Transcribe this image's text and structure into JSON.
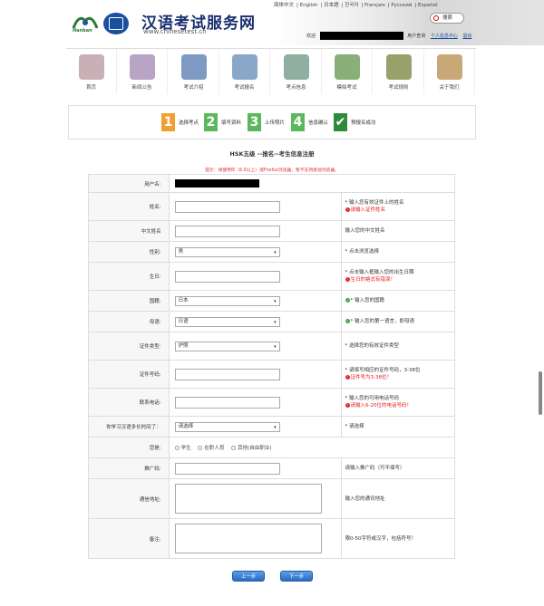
{
  "header": {
    "site_title": "汉语考试服务网",
    "site_url": "www.chinesetest.cn",
    "logo_text": "Hanban",
    "languages": [
      "简体中文",
      "English",
      "日本語",
      "한국어",
      "Français",
      "Русский",
      "Español"
    ],
    "search_label": "搜索",
    "welcome": "欢迎",
    "user_center": "用户查询",
    "personal_center": "个人信息中心",
    "logout": "退出"
  },
  "nav": {
    "items": [
      {
        "label": "首页",
        "color": "#c9b0b6"
      },
      {
        "label": "新闻公告",
        "color": "#b8a4c4"
      },
      {
        "label": "考试介绍",
        "color": "#7f9ac2"
      },
      {
        "label": "考试报名",
        "color": "#8aa6c8"
      },
      {
        "label": "考点信息",
        "color": "#8fb0a0"
      },
      {
        "label": "模拟考试",
        "color": "#8ab07a"
      },
      {
        "label": "考试规则",
        "color": "#9aa06a"
      },
      {
        "label": "关于我们",
        "color": "#c8a878"
      }
    ]
  },
  "steps": [
    {
      "num": "1",
      "label": "选择考点",
      "color": "#f0a030"
    },
    {
      "num": "2",
      "label": "填写资料",
      "color": "#5cb85c"
    },
    {
      "num": "3",
      "label": "上传照片",
      "color": "#5cb85c"
    },
    {
      "num": "4",
      "label": "信息确认",
      "color": "#5cb85c"
    },
    {
      "num": "✔",
      "label": "预报名成功",
      "color": "#2e8b3a"
    }
  ],
  "form": {
    "title": "HSK五级 --报名--考生信息注册",
    "hint": "提示：请使用IE（6.0以上）或Firefox浏览器，暂不支持其他浏览器。",
    "rows": {
      "username": {
        "label": "用户名:"
      },
      "name": {
        "label": "姓名:",
        "tip": "* 输入您有效证件上的姓名",
        "error": "请输入证件姓名"
      },
      "chinese_name": {
        "label": "中文姓名",
        "tip": "输入您的中文姓名"
      },
      "gender": {
        "label": "性别:",
        "value": "男",
        "tip": "* 点击浏览选择"
      },
      "birthday": {
        "label": "生日:",
        "tip": "* 点击输入框输入您的出生日期",
        "error": "生日的格式有错误！"
      },
      "nationality": {
        "label": "国籍:",
        "value": "日本",
        "tip": "* 输入您的国籍"
      },
      "mother_tongue": {
        "label": "母语:",
        "value": "日语",
        "tip": "* 输入您的第一语言，即母语"
      },
      "id_type": {
        "label": "证件类型:",
        "value": "护照",
        "tip": "* 选择您的有效证件类型"
      },
      "id_number": {
        "label": "证件号码:",
        "tip": "* 请填写相应的证件号码，3-38位",
        "error": "证件号为3-38位！"
      },
      "phone": {
        "label": "联系电话:",
        "tip": "* 输入您的可用电话号码",
        "error": "请输入6-20位的电话号码！"
      },
      "study_time": {
        "label": "你学习汉语多长时间了：",
        "value": "请选择",
        "tip": "* 请选择"
      },
      "identity": {
        "label": "您是:",
        "options": [
          "学生",
          "在职人员",
          "其他(自由职业)"
        ]
      },
      "referral": {
        "label": "推广码:",
        "tip": "请输入推广码（可不填写）"
      },
      "address": {
        "label": "通信地址:",
        "tip": "输入您的通讯地址"
      },
      "remark": {
        "label": "备注:",
        "tip": "限0-50字符或汉字，包括符号！"
      }
    }
  },
  "buttons": {
    "prev": "上一步",
    "next": "下一步"
  }
}
